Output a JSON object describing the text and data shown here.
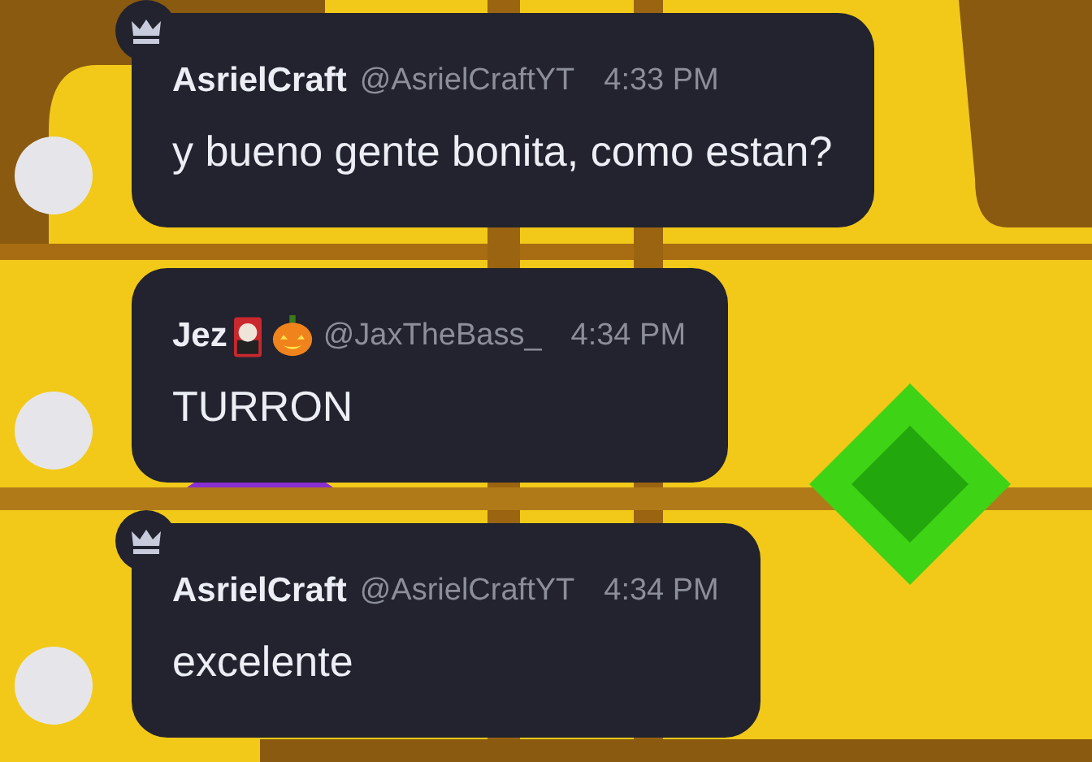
{
  "messages": [
    {
      "owner": true,
      "name": "AsrielCraft",
      "handle": "@AsrielCraftYT",
      "time": "4:33 PM",
      "text": "y bueno gente bonita, como estan?"
    },
    {
      "owner": false,
      "name": "Jez",
      "badges": [
        {
          "kind": "card"
        },
        {
          "kind": "pumpkin"
        }
      ],
      "handle": "@JaxTheBass_",
      "time": "4:34 PM",
      "text": "TURRON"
    },
    {
      "owner": true,
      "name": "AsrielCraft",
      "handle": "@AsrielCraftYT",
      "time": "4:34 PM",
      "text": "excelente"
    }
  ]
}
